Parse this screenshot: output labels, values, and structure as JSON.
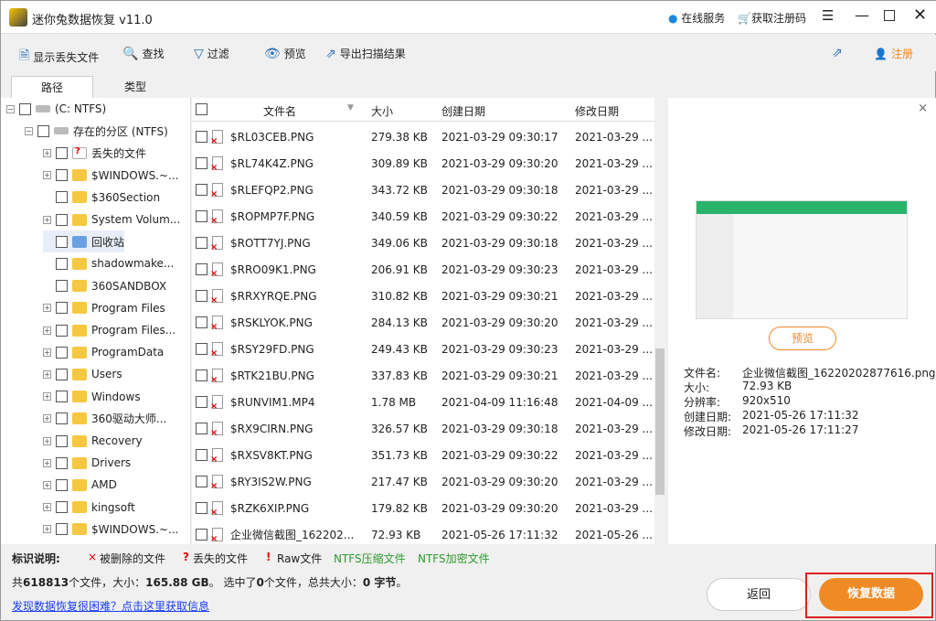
{
  "app": {
    "title": "迷你兔数据恢复 v11.0",
    "online": "在线服务",
    "register_code": "获取注册码"
  },
  "toolbar": {
    "show_lost": "显示丢失文件",
    "find": "查找",
    "filter": "过滤",
    "preview": "预览",
    "export": "导出扫描结果",
    "register": "注册"
  },
  "tabs": [
    "路径",
    "类型"
  ],
  "tree": [
    {
      "label": "(C: NTFS)",
      "level": 0,
      "exp": "−",
      "icon": "drive"
    },
    {
      "label": "存在的分区 (NTFS)",
      "level": 1,
      "exp": "−",
      "icon": "drive"
    },
    {
      "label": "丢失的文件",
      "level": 2,
      "exp": "+",
      "icon": "lost"
    },
    {
      "label": "$WINDOWS.~...",
      "level": 2,
      "exp": "+",
      "icon": "folder"
    },
    {
      "label": "$360Section",
      "level": 2,
      "exp": "",
      "icon": "folder"
    },
    {
      "label": "System Volum...",
      "level": 2,
      "exp": "+",
      "icon": "folder"
    },
    {
      "label": "回收站",
      "level": 2,
      "exp": "",
      "icon": "recycle"
    },
    {
      "label": "shadowmake...",
      "level": 2,
      "exp": "",
      "icon": "folder"
    },
    {
      "label": "360SANDBOX",
      "level": 2,
      "exp": "",
      "icon": "folder"
    },
    {
      "label": "Program Files",
      "level": 2,
      "exp": "+",
      "icon": "folder"
    },
    {
      "label": "Program Files...",
      "level": 2,
      "exp": "+",
      "icon": "folder"
    },
    {
      "label": "ProgramData",
      "level": 2,
      "exp": "+",
      "icon": "folder"
    },
    {
      "label": "Users",
      "level": 2,
      "exp": "+",
      "icon": "folder"
    },
    {
      "label": "Windows",
      "level": 2,
      "exp": "+",
      "icon": "folder"
    },
    {
      "label": "360驱动大师...",
      "level": 2,
      "exp": "+",
      "icon": "folder"
    },
    {
      "label": "Recovery",
      "level": 2,
      "exp": "+",
      "icon": "folder"
    },
    {
      "label": "Drivers",
      "level": 2,
      "exp": "+",
      "icon": "folder"
    },
    {
      "label": "AMD",
      "level": 2,
      "exp": "+",
      "icon": "folder"
    },
    {
      "label": "kingsoft",
      "level": 2,
      "exp": "+",
      "icon": "folder"
    },
    {
      "label": "$WINDOWS.~...",
      "level": 2,
      "exp": "+",
      "icon": "folder"
    }
  ],
  "list": {
    "headers": [
      "文件名",
      "大小",
      "创建日期",
      "修改日期"
    ],
    "rows": [
      [
        "$RL03CEB.PNG",
        "279.38 KB",
        "2021-03-29 09:30:17",
        "2021-03-29 ..."
      ],
      [
        "$RL74K4Z.PNG",
        "309.89 KB",
        "2021-03-29 09:30:20",
        "2021-03-29 ..."
      ],
      [
        "$RLEFQP2.PNG",
        "343.72 KB",
        "2021-03-29 09:30:18",
        "2021-03-29 ..."
      ],
      [
        "$ROPMP7F.PNG",
        "340.59 KB",
        "2021-03-29 09:30:22",
        "2021-03-29 ..."
      ],
      [
        "$ROTT7YJ.PNG",
        "349.06 KB",
        "2021-03-29 09:30:18",
        "2021-03-29 ..."
      ],
      [
        "$RRO09K1.PNG",
        "206.91 KB",
        "2021-03-29 09:30:23",
        "2021-03-29 ..."
      ],
      [
        "$RRXYRQE.PNG",
        "310.82 KB",
        "2021-03-29 09:30:21",
        "2021-03-29 ..."
      ],
      [
        "$RSKLYOK.PNG",
        "284.13 KB",
        "2021-03-29 09:30:20",
        "2021-03-29 ..."
      ],
      [
        "$RSY29FD.PNG",
        "249.43 KB",
        "2021-03-29 09:30:23",
        "2021-03-29 ..."
      ],
      [
        "$RTK21BU.PNG",
        "337.83 KB",
        "2021-03-29 09:30:21",
        "2021-03-29 ..."
      ],
      [
        "$RUNVIM1.MP4",
        "1.78 MB",
        "2021-04-09 11:16:48",
        "2021-04-09 ..."
      ],
      [
        "$RX9CIRN.PNG",
        "326.57 KB",
        "2021-03-29 09:30:18",
        "2021-03-29 ..."
      ],
      [
        "$RXSV8KT.PNG",
        "351.73 KB",
        "2021-03-29 09:30:22",
        "2021-03-29 ..."
      ],
      [
        "$RY3IS2W.PNG",
        "217.47 KB",
        "2021-03-29 09:30:20",
        "2021-03-29 ..."
      ],
      [
        "$RZK6XIP.PNG",
        "179.82 KB",
        "2021-03-29 09:30:20",
        "2021-03-29 ..."
      ],
      [
        "企业微信截图_162202...",
        "72.93 KB",
        "2021-05-26 17:11:32",
        "2021-05-26 ..."
      ]
    ]
  },
  "preview": {
    "button": "预览",
    "labels": [
      "文件名:",
      "大小:",
      "分辨率:",
      "创建日期:",
      "修改日期:"
    ],
    "values": [
      "企业微信截图_16220202877616.png",
      "72.93 KB",
      "920x510",
      "2021-05-26 17:11:32",
      "2021-05-26 17:11:27"
    ]
  },
  "legend": {
    "title": "标识说明:",
    "deleted": "被删除的文件",
    "lost": "丢失的文件",
    "raw": "Raw文件",
    "ntfs_comp": "NTFS压缩文件",
    "ntfs_enc": "NTFS加密文件"
  },
  "status": {
    "p1": "共",
    "count": "618813",
    "p2": "个文件，大小：",
    "size": "165.88 GB",
    "p3": "。 选中了",
    "sel": "0",
    "p4": "个文件，总共大小：",
    "selsize": "0 字节",
    "p5": "。"
  },
  "help_link": "发现数据恢复很困难？点击这里获取信息",
  "buttons": {
    "back": "返回",
    "recover": "恢复数据"
  },
  "colors": {
    "accent": "#f08a24",
    "ntfs": "#2e9b2e",
    "link": "#1a3cff"
  }
}
